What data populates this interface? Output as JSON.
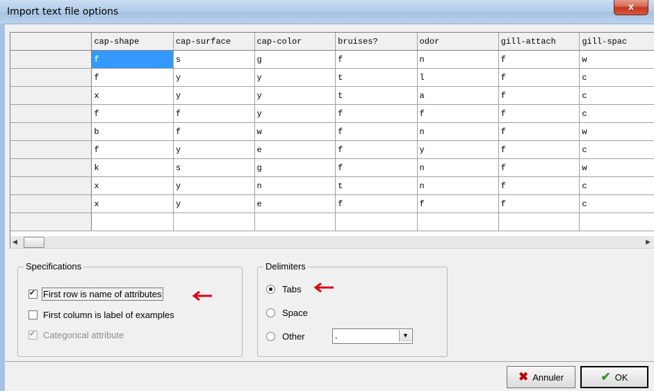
{
  "window": {
    "title": "Import text file options",
    "close": "x"
  },
  "grid": {
    "headers": [
      "cap-shape",
      "cap-surface",
      "cap-color",
      "bruises?",
      "odor",
      "gill-attach",
      "gill-spac"
    ],
    "rows": [
      [
        "f",
        "s",
        "g",
        "f",
        "n",
        "f",
        "w"
      ],
      [
        "f",
        "y",
        "y",
        "t",
        "l",
        "f",
        "c"
      ],
      [
        "x",
        "y",
        "y",
        "t",
        "a",
        "f",
        "c"
      ],
      [
        "f",
        "f",
        "y",
        "f",
        "f",
        "f",
        "c"
      ],
      [
        "b",
        "f",
        "w",
        "f",
        "n",
        "f",
        "w"
      ],
      [
        "f",
        "y",
        "e",
        "f",
        "y",
        "f",
        "c"
      ],
      [
        "k",
        "s",
        "g",
        "f",
        "n",
        "f",
        "w"
      ],
      [
        "x",
        "y",
        "n",
        "t",
        "n",
        "f",
        "c"
      ],
      [
        "x",
        "y",
        "e",
        "f",
        "f",
        "f",
        "c"
      ]
    ]
  },
  "scrollbar": {
    "left_arrow": "◀",
    "right_arrow": "▶"
  },
  "specifications": {
    "legend": "Specifications",
    "first_row": {
      "label": "First row is name of attributes",
      "checked": true
    },
    "first_col": {
      "label": "First column is label of examples",
      "checked": false
    },
    "categorical": {
      "label": "Categorical attribute",
      "checked": true,
      "enabled": false
    }
  },
  "delimiters": {
    "legend": "Delimiters",
    "tabs": {
      "label": "Tabs",
      "selected": true
    },
    "space": {
      "label": "Space",
      "selected": false
    },
    "other": {
      "label": "Other",
      "selected": false,
      "value": ","
    }
  },
  "buttons": {
    "cancel": "Annuler",
    "ok": "OK",
    "cancel_icon": "✖",
    "ok_icon": "✔"
  },
  "colors": {
    "annotation_arrow": "#e0000f",
    "selection": "#3399ff",
    "ok_check": "#2e9a1e",
    "cancel_x": "#c00000"
  }
}
